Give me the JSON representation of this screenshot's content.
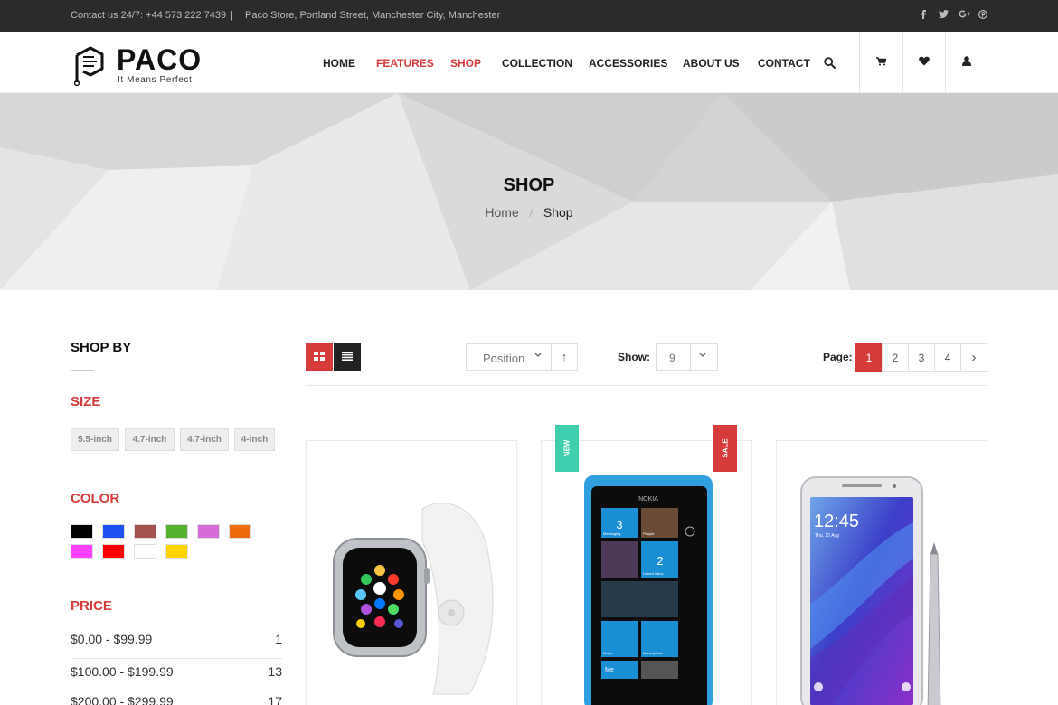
{
  "topbar": {
    "contact": "Contact us 24/7: +44 573 222 7439",
    "separator": "|",
    "address": "Paco Store, Portland Street, Manchester City, Manchester",
    "social_icons": [
      "facebook-icon",
      "twitter-icon",
      "google-plus-icon",
      "pinterest-icon"
    ]
  },
  "brand": {
    "name": "PACO",
    "tagline": "It Means Perfect"
  },
  "nav": {
    "items": [
      "HOME",
      "FEATURES",
      "SHOP",
      "COLLECTION",
      "ACCESSORIES",
      "ABOUT US",
      "CONTACT"
    ],
    "highlighted": [
      "FEATURES",
      "SHOP"
    ],
    "icons": [
      "search-icon",
      "cart-icon",
      "heart-icon",
      "user-icon"
    ]
  },
  "banner": {
    "title": "SHOP",
    "breadcrumb": [
      "Home",
      "Shop"
    ],
    "breadcrumb_sep": "/"
  },
  "sidebar": {
    "title": "SHOP BY",
    "size_heading": "SIZE",
    "sizes": [
      "5.5-inch",
      "4.7-inch",
      "4.7-inch",
      "4-inch"
    ],
    "color_heading": "COLOR",
    "colors": [
      "#000000",
      "#1d50f0",
      "#a3524f",
      "#56b12f",
      "#d56cd7",
      "#ef6a0b",
      "#ff40ff",
      "#ff0000",
      "#ffffff",
      "#ffd400"
    ],
    "price_heading": "PRICE",
    "prices": [
      {
        "label": "$0.00 - $99.99",
        "count": "1"
      },
      {
        "label": "$100.00 - $199.99",
        "count": "13"
      },
      {
        "label": "$200.00 - $299.99",
        "count": "17"
      }
    ]
  },
  "toolbar": {
    "sort_value": "Position",
    "sort_dir_symbol": "↑",
    "show_label": "Show:",
    "show_value": "9",
    "page_label": "Page:",
    "pages": [
      "1",
      "2",
      "3",
      "4"
    ],
    "current_page": "1",
    "next_symbol": "›"
  },
  "products": {
    "badges": {
      "new": "NEW",
      "sale": "SALE"
    },
    "phone_brand": "NOKIA",
    "tiles": [
      "3",
      "2"
    ],
    "tile_captions": [
      "Messaging",
      "People",
      "Linked inbox",
      "Music",
      "Marketplace",
      "Me"
    ],
    "clock": "12:45",
    "date": "Thu, 12 Aug"
  },
  "accent_color": "#d63b3b"
}
